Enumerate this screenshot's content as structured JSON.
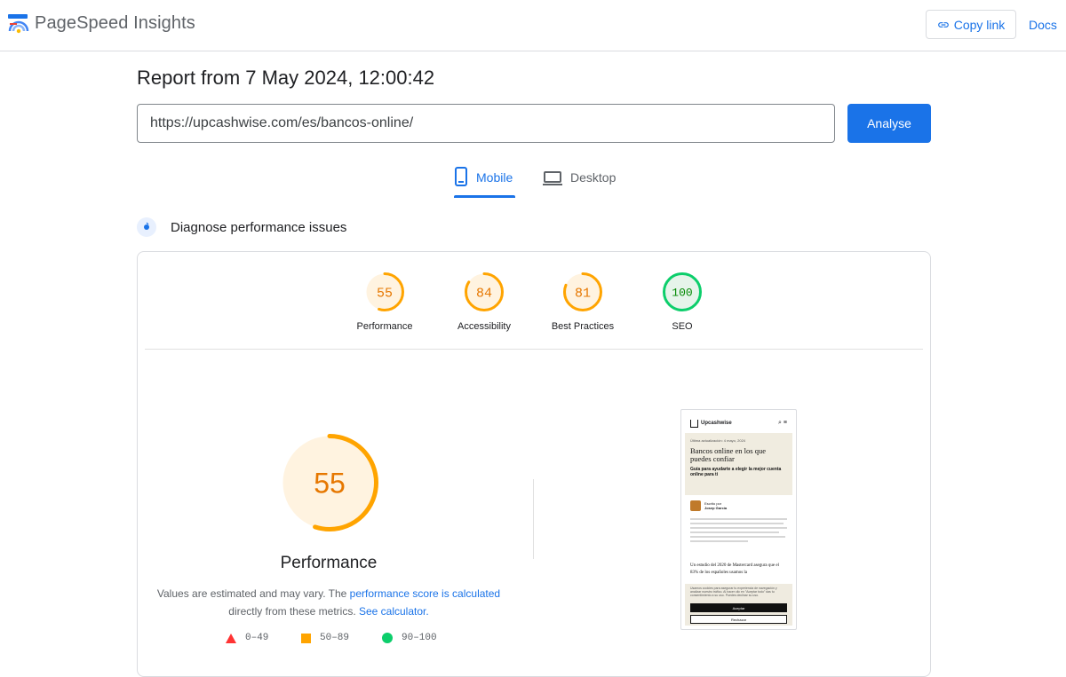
{
  "header": {
    "brand": "PageSpeed Insights",
    "copy_link": "Copy link",
    "docs": "Docs"
  },
  "report": {
    "title": "Report from 7 May 2024, 12:00:42",
    "url": "https://upcashwise.com/es/bancos-online/",
    "analyse": "Analyse"
  },
  "tabs": [
    {
      "label": "Mobile",
      "active": true
    },
    {
      "label": "Desktop",
      "active": false
    }
  ],
  "diagnose": {
    "title": "Diagnose performance issues"
  },
  "scores": [
    {
      "value": "55",
      "label": "Performance",
      "score": 0.55,
      "color": "#e67700",
      "ring": "#ffa400",
      "bg": "#fff3e0"
    },
    {
      "value": "84",
      "label": "Accessibility",
      "score": 0.84,
      "color": "#e67700",
      "ring": "#ffa400",
      "bg": "#fff3e0"
    },
    {
      "value": "81",
      "label": "Best Practices",
      "score": 0.81,
      "color": "#e67700",
      "ring": "#ffa400",
      "bg": "#fff3e0"
    },
    {
      "value": "100",
      "label": "SEO",
      "score": 1.0,
      "color": "#008800",
      "ring": "#0cce6b",
      "bg": "#e6f4ea"
    }
  ],
  "performance": {
    "score": "55",
    "score_fraction": 0.55,
    "title": "Performance",
    "note_prefix": "Values are estimated and may vary. The ",
    "note_link1": "performance score is calculated",
    "note_mid": "directly from these metrics. ",
    "note_link2": "See calculator."
  },
  "legend": [
    {
      "range": "0–49",
      "shape": "triangle",
      "color": "#ff3333"
    },
    {
      "range": "50–89",
      "shape": "square",
      "color": "#ffa400"
    },
    {
      "range": "90–100",
      "shape": "circle",
      "color": "#0cce6b"
    }
  ],
  "phone": {
    "brand": "Upcashwise",
    "date": "Última actualización: 4 mayo, 2024",
    "heading": "Bancos online en los que puedes confiar",
    "subheading": "Guía para ayudarte a elegir la mejor cuenta online para ti",
    "author_label": "Escrito por",
    "author_name": "Josep García",
    "body": "Un estudio del 2020 de Mastercard asegura que el 83% de los españoles usamos la",
    "cookie_text": "Usamos cookies para asegurar tu experiencia de navegación y analizar nuestro tráfico. Al hacer clic en \"Aceptar todo\" das tu consentimiento a su uso. Puedes declinar su uso.",
    "accept": "Aceptar",
    "reject": "Rechazar"
  },
  "colors": {
    "accent": "#1a73e8",
    "average": "#ffa400",
    "good": "#0cce6b",
    "poor": "#ff3333"
  }
}
